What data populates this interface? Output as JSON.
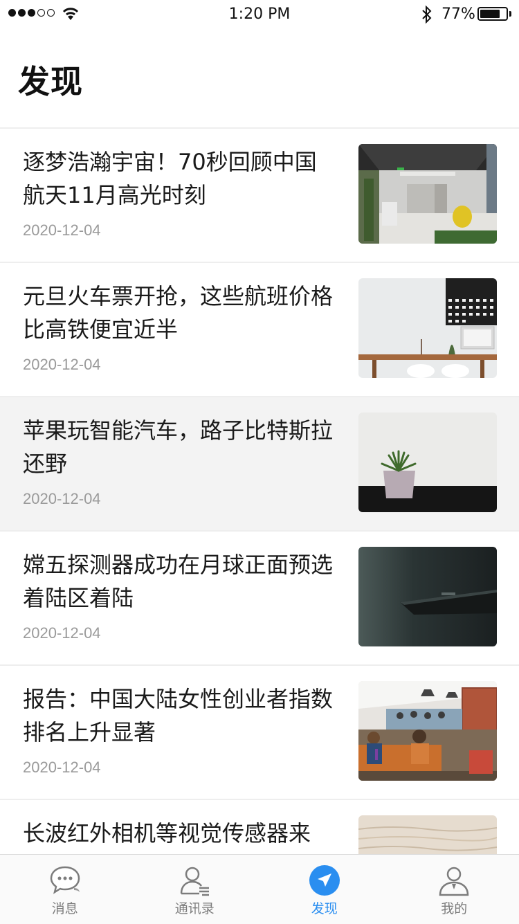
{
  "status_bar": {
    "time": "1:20 PM",
    "battery": "77%",
    "battery_level": 0.77,
    "signal_bars": 3
  },
  "page": {
    "title": "发现"
  },
  "news": [
    {
      "title": "逐梦浩瀚宇宙！70秒回顾中国航天11月高光时刻",
      "date": "2020-12-04",
      "thumb_icon": "office-lobby-photo"
    },
    {
      "title": "元旦火车票开抢，这些航班价格比高铁便宜近半",
      "date": "2020-12-04",
      "thumb_icon": "desk-calendar-photo"
    },
    {
      "title": "苹果玩智能汽车，路子比特斯拉还野",
      "date": "2020-12-04",
      "thumb_icon": "plant-pot-photo"
    },
    {
      "title": "嫦五探测器成功在月球正面预选着陆区着陆",
      "date": "2020-12-04",
      "thumb_icon": "dark-laptop-photo"
    },
    {
      "title": "报告：中国大陆女性创业者指数排名上升显著",
      "date": "2020-12-04",
      "thumb_icon": "coworking-space-photo"
    },
    {
      "title": "长波红外相机等视觉传感器来",
      "date": "",
      "thumb_icon": "wood-texture-photo"
    }
  ],
  "tabs": [
    {
      "label": "消息",
      "icon": "chat-bubble-icon",
      "active": false
    },
    {
      "label": "通讯录",
      "icon": "contacts-icon",
      "active": false
    },
    {
      "label": "发现",
      "icon": "compass-icon",
      "active": true
    },
    {
      "label": "我的",
      "icon": "profile-icon",
      "active": false
    }
  ],
  "colors": {
    "accent": "#2a8ef0",
    "tab_inactive": "#7c7c7c",
    "date": "#9a9a9a",
    "highlight_row": "#f3f3f3"
  }
}
